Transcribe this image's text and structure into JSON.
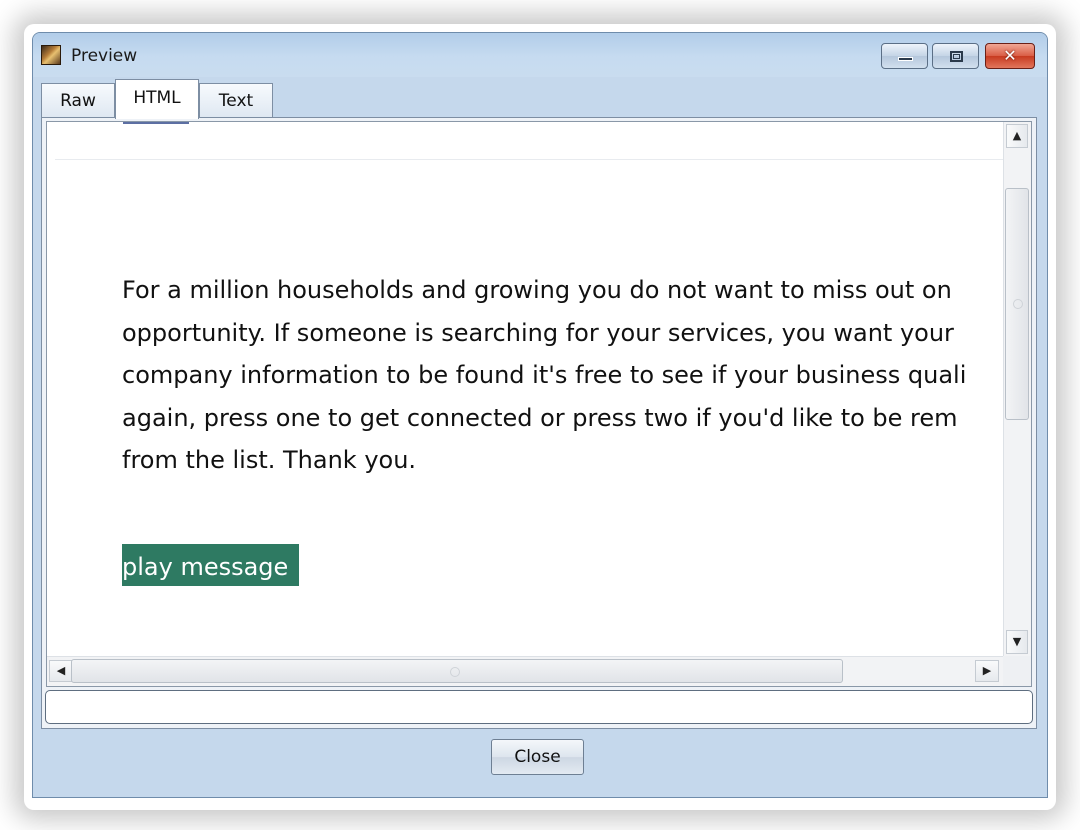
{
  "window": {
    "title": "Preview",
    "controls": {
      "minimize": "",
      "maximize": "",
      "close": "✕"
    }
  },
  "tabs": [
    {
      "label": "Raw",
      "selected": false
    },
    {
      "label": "HTML",
      "selected": true
    },
    {
      "label": "Text",
      "selected": false
    }
  ],
  "content": {
    "paragraph": "For a million households and growing you do not want to miss out on\nopportunity. If someone is searching for your services, you want your\ncompany information to be found it's free to see if your business quali\nagain, press one to get connected or press two if you'd like to be rem\nfrom the list. Thank you.",
    "play_button": "play message",
    "play_button_color": "#2e7a62"
  },
  "scrollbars": {
    "up_arrow": "▲",
    "down_arrow": "▼",
    "left_arrow": "◀",
    "right_arrow": "▶"
  },
  "status_field": {
    "value": ""
  },
  "footer": {
    "close_label": "Close"
  },
  "icons": {
    "app": "preview-app-icon",
    "minimize": "minimize-icon",
    "maximize": "maximize-icon",
    "close": "close-icon"
  }
}
